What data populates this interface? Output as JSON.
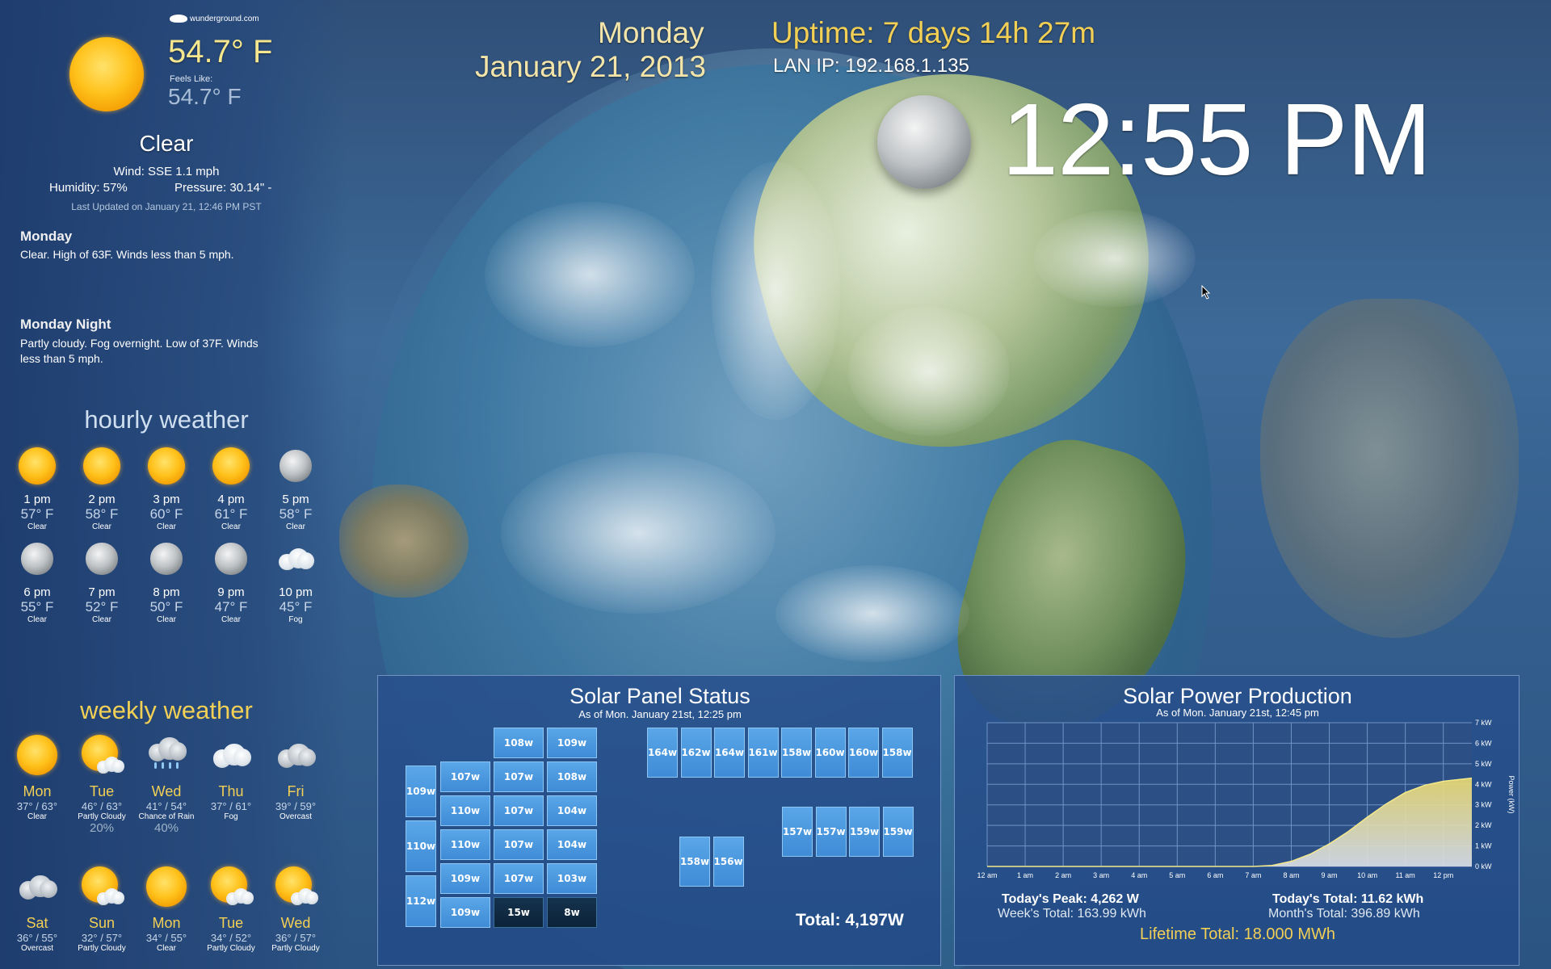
{
  "weather": {
    "brand": "wunderground.com",
    "current_temp": "54.7° F",
    "feels_like_label": "Feels Like:",
    "feels_like_temp": "54.7° F",
    "condition": "Clear",
    "wind": "Wind: SSE 1.1 mph",
    "humidity": "Humidity: 57%",
    "pressure": "Pressure: 30.14\" -",
    "last_updated": "Last Updated on January 21, 12:46 PM PST",
    "forecast": [
      {
        "title": "Monday",
        "text": "Clear. High of 63F. Winds less than 5 mph."
      },
      {
        "title": "Monday Night",
        "text_line1": "Partly cloudy. Fog overnight. Low of 37F. Winds",
        "text_line2": "less than 5 mph."
      }
    ],
    "hourly_title": "hourly weather",
    "hourly": [
      {
        "time": "1 pm",
        "temp": "57° F",
        "cond": "Clear",
        "icon": "sun-icon"
      },
      {
        "time": "2 pm",
        "temp": "58° F",
        "cond": "Clear",
        "icon": "sun-icon"
      },
      {
        "time": "3 pm",
        "temp": "60° F",
        "cond": "Clear",
        "icon": "sun-icon"
      },
      {
        "time": "4 pm",
        "temp": "61° F",
        "cond": "Clear",
        "icon": "sun-icon"
      },
      {
        "time": "5 pm",
        "temp": "58° F",
        "cond": "Clear",
        "icon": "moon-icon"
      },
      {
        "time": "6 pm",
        "temp": "55° F",
        "cond": "Clear",
        "icon": "moon-icon"
      },
      {
        "time": "7 pm",
        "temp": "52° F",
        "cond": "Clear",
        "icon": "moon-icon"
      },
      {
        "time": "8 pm",
        "temp": "50° F",
        "cond": "Clear",
        "icon": "moon-icon"
      },
      {
        "time": "9 pm",
        "temp": "47° F",
        "cond": "Clear",
        "icon": "moon-icon"
      },
      {
        "time": "10 pm",
        "temp": "45° F",
        "cond": "Fog",
        "icon": "fog-cloud-icon"
      }
    ],
    "weekly_title": "weekly weather",
    "weekly": [
      {
        "day": "Mon",
        "temp": "37° / 63°",
        "cond": "Clear",
        "pct": "",
        "icon": "sun-icon"
      },
      {
        "day": "Tue",
        "temp": "46° / 63°",
        "cond": "Partly Cloudy",
        "pct": "20%",
        "icon": "partly-cloudy-icon"
      },
      {
        "day": "Wed",
        "temp": "41° / 54°",
        "cond": "Chance of Rain",
        "pct": "40%",
        "icon": "rain-cloud-icon"
      },
      {
        "day": "Thu",
        "temp": "37° / 61°",
        "cond": "Fog",
        "pct": "",
        "icon": "fog-cloud-icon"
      },
      {
        "day": "Fri",
        "temp": "39° / 59°",
        "cond": "Overcast",
        "pct": "",
        "icon": "overcast-icon"
      },
      {
        "day": "Sat",
        "temp": "36° / 55°",
        "cond": "Overcast",
        "pct": "",
        "icon": "overcast-icon"
      },
      {
        "day": "Sun",
        "temp": "32° / 57°",
        "cond": "Partly Cloudy",
        "pct": "",
        "icon": "partly-cloudy-icon"
      },
      {
        "day": "Mon",
        "temp": "34° / 55°",
        "cond": "Clear",
        "pct": "",
        "icon": "sun-icon"
      },
      {
        "day": "Tue",
        "temp": "34° / 52°",
        "cond": "Partly Cloudy",
        "pct": "",
        "icon": "partly-cloudy-icon"
      },
      {
        "day": "Wed",
        "temp": "36° / 57°",
        "cond": "Partly Cloudy",
        "pct": "",
        "icon": "partly-cloudy-icon"
      }
    ]
  },
  "header": {
    "day": "Monday",
    "date": "January 21, 2013",
    "uptime": "Uptime: 7 days 14h 27m",
    "lan_ip": "LAN IP: 192.168.1.135",
    "clock": "12:55 PM"
  },
  "solar_status": {
    "title": "Solar Panel Status",
    "subtitle": "As of Mon. January 21st, 12:25 pm",
    "total": "Total: 4,197W",
    "left_array": {
      "tall": [
        "109w",
        "110w",
        "112w"
      ],
      "rows": [
        [
          "",
          "108w",
          "109w"
        ],
        [
          "107w",
          "107w",
          "108w"
        ],
        [
          "110w",
          "107w",
          "104w"
        ],
        [
          "110w",
          "107w",
          "104w"
        ],
        [
          "109w",
          "107w",
          "103w"
        ],
        [
          "109w",
          "15w",
          "8w"
        ]
      ]
    },
    "top_row": [
      "164w",
      "162w",
      "164w",
      "161w",
      "158w",
      "160w",
      "160w",
      "158w"
    ],
    "mid_pair": [
      "158w",
      "156w"
    ],
    "right_row": [
      "157w",
      "157w",
      "159w",
      "159w"
    ]
  },
  "solar_production": {
    "title": "Solar Power Production",
    "subtitle": "As of Mon. January 21st, 12:45 pm",
    "todays_peak": "Today's Peak: 4,262 W",
    "weeks_total": "Week's Total: 163.99 kWh",
    "todays_total": "Today's Total: 11.62 kWh",
    "months_total": "Month's Total: 396.89 kWh",
    "lifetime_total": "Lifetime Total: 18.000 MWh"
  },
  "chart_data": {
    "type": "area",
    "title": "Solar Power Production",
    "xlabel": "",
    "ylabel": "Power (kW)",
    "x_ticks": [
      "12 am",
      "1 am",
      "2 am",
      "3 am",
      "4 am",
      "5 am",
      "6 am",
      "7 am",
      "8 am",
      "9 am",
      "10 am",
      "11 am",
      "12 pm"
    ],
    "y_ticks": [
      "0 kW",
      "1 kW",
      "2 kW",
      "3 kW",
      "4 kW",
      "5 kW",
      "6 kW",
      "7 kW"
    ],
    "ylim": [
      0,
      7
    ],
    "xlim": [
      0,
      12.75
    ],
    "grid": true,
    "series": [
      {
        "x": [
          0,
          7,
          7.5,
          8,
          8.5,
          9,
          9.5,
          10,
          10.5,
          11,
          11.5,
          12,
          12.5,
          12.75
        ],
        "values": [
          0,
          0,
          0.05,
          0.25,
          0.6,
          1.1,
          1.7,
          2.4,
          3.05,
          3.6,
          3.95,
          4.15,
          4.25,
          4.3
        ]
      }
    ],
    "colors": {
      "fill_top": "#e8d870",
      "fill_bottom": "#d8dde6",
      "grid": "#6f93c4",
      "plot_bg": "#2c4f86"
    }
  }
}
